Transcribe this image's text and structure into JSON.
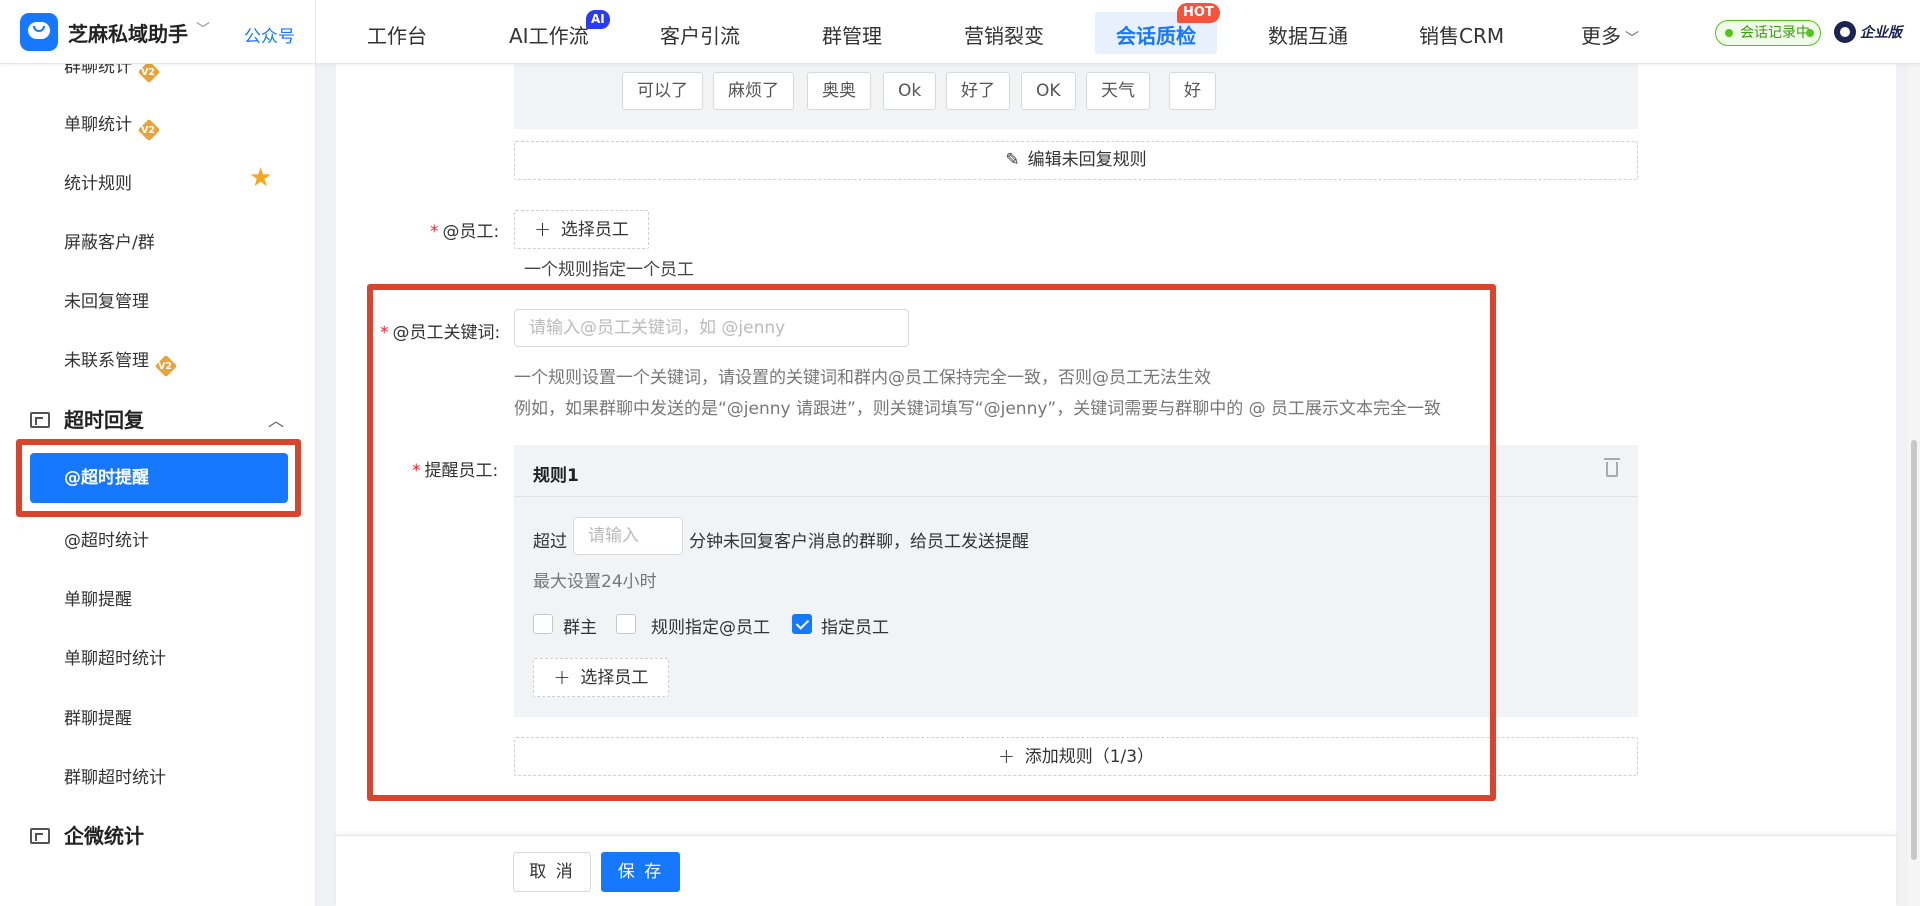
{
  "topbar": {
    "brand_name": "芝麻私域助手",
    "brand_caret": "﹀",
    "gzh_link": "公众号",
    "nav": [
      {
        "label": "工作台"
      },
      {
        "label": "AI工作流",
        "badge": "AI"
      },
      {
        "label": "客户引流"
      },
      {
        "label": "群管理"
      },
      {
        "label": "营销裂变"
      },
      {
        "label": "会话质检",
        "badge": "HOT",
        "active": true
      },
      {
        "label": "数据互通"
      },
      {
        "label": "销售CRM"
      },
      {
        "label": "更多"
      }
    ],
    "more_caret": "﹀",
    "record_status": "会话记录中",
    "enterprise_label": "企业版"
  },
  "sidebar": {
    "items": [
      {
        "label": "群聊统计",
        "badge": "V2"
      },
      {
        "label": "单聊统计",
        "badge": "V2"
      },
      {
        "label": "统计规则",
        "star": true
      },
      {
        "label": "屏蔽客户/群"
      },
      {
        "label": "未回复管理"
      },
      {
        "label": "未联系管理",
        "badge": "V2"
      }
    ],
    "group_overtime": "超时回复",
    "group_caret": "︿",
    "overtime_items": [
      {
        "label": "@超时提醒",
        "active": true
      },
      {
        "label": "@超时统计"
      },
      {
        "label": "单聊提醒"
      },
      {
        "label": "单聊超时统计"
      },
      {
        "label": "群聊提醒"
      },
      {
        "label": "群聊超时统计"
      }
    ],
    "group_wecom": "企微统计"
  },
  "form": {
    "keywords": [
      "可以了",
      "麻烦了",
      "奥奥",
      "Ok",
      "好了",
      "OK",
      "天气",
      "好"
    ],
    "edit_rule_button": "编辑未回复规则",
    "employee_label": "@员工:",
    "select_employee_button": "选择员工",
    "employee_hint": "一个规则指定一个员工",
    "keyword_label": "@员工关键词:",
    "keyword_placeholder": "请输入@员工关键词，如 @jenny",
    "keyword_hint1": "一个规则设置一个关键词，请设置的关键词和群内@员工保持完全一致，否则@员工无法生效",
    "keyword_hint2": "例如，如果群聊中发送的是“@jenny 请跟进”，则关键词填写“@jenny”，关键词需要与群聊中的 @ 员工展示文本完全一致",
    "remind_label": "提醒员工:",
    "rule": {
      "title": "规则1",
      "exceed_prefix": "超过",
      "minutes_placeholder": "请输入",
      "exceed_suffix": "分钟未回复客户消息的群聊，给员工发送提醒",
      "max_hint": "最大设置24小时",
      "checkboxes": [
        {
          "label": "群主",
          "checked": false
        },
        {
          "label": "规则指定@员工",
          "checked": false
        },
        {
          "label": "指定员工",
          "checked": true
        }
      ],
      "select_employee_button": "选择员工"
    },
    "add_rule_button": "添加规则（1/3）"
  },
  "footer": {
    "cancel": "取 消",
    "save": "保 存"
  },
  "colors": {
    "primary": "#1677ff",
    "highlight_box": "#d9452c",
    "required": "#f5222d",
    "record_green": "#52c41a",
    "badge_hot": "#f5533d",
    "badge_ai": "#2b3cf0",
    "star": "#f5a623"
  },
  "icons": [
    "app-logo-icon",
    "edit-icon",
    "plus-icon",
    "trash-icon",
    "star-icon",
    "record-dot-icon",
    "enterprise-logo-icon"
  ]
}
